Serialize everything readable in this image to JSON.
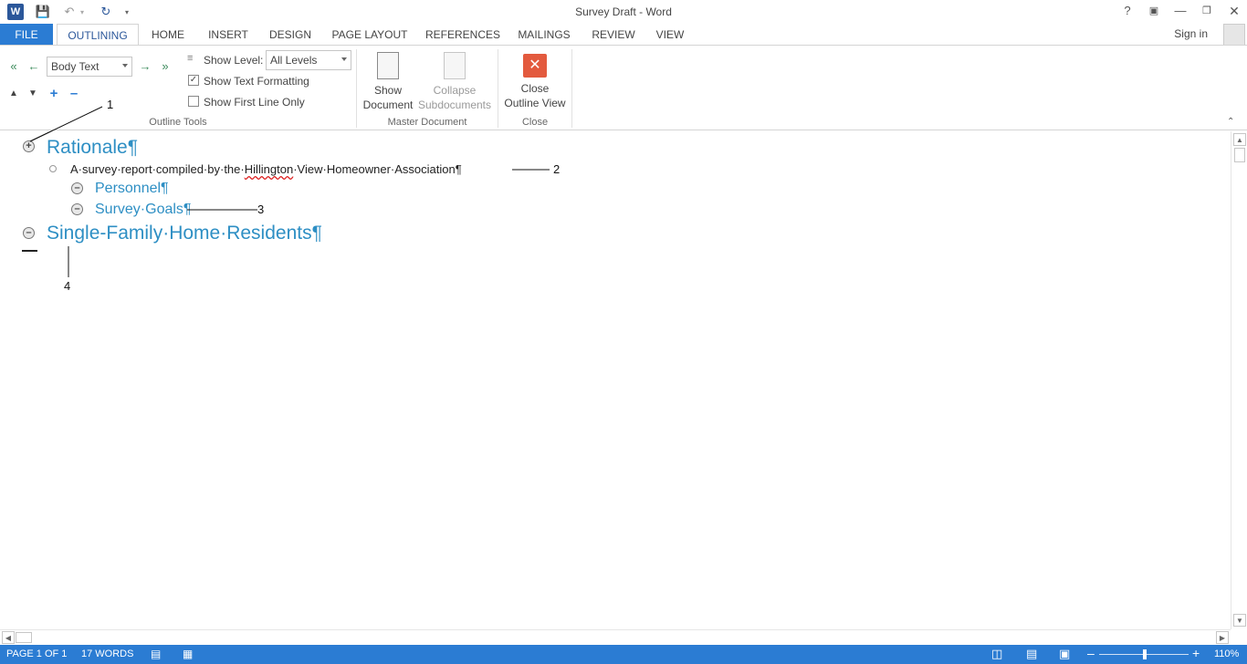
{
  "window": {
    "title": "Survey Draft - Word",
    "help": "?"
  },
  "tabs": [
    {
      "label": "FILE"
    },
    {
      "label": "OUTLINING"
    },
    {
      "label": "HOME"
    },
    {
      "label": "INSERT"
    },
    {
      "label": "DESIGN"
    },
    {
      "label": "PAGE LAYOUT"
    },
    {
      "label": "REFERENCES"
    },
    {
      "label": "MAILINGS"
    },
    {
      "label": "REVIEW"
    },
    {
      "label": "VIEW"
    }
  ],
  "account": {
    "signin": "Sign in"
  },
  "ribbon": {
    "outline_tools": {
      "level_value": "Body Text",
      "show_level_label": "Show Level:",
      "show_level_value": "All Levels",
      "show_text_formatting": "Show Text Formatting",
      "show_text_formatting_checked": true,
      "show_first_line_only": "Show First Line Only",
      "show_first_line_only_checked": false,
      "group_label": "Outline Tools"
    },
    "master_document": {
      "show_document_line1": "Show",
      "show_document_line2": "Document",
      "collapse_line1": "Collapse",
      "collapse_line2": "Subdocuments",
      "group_label": "Master Document"
    },
    "close": {
      "close_line1": "Close",
      "close_line2": "Outline View",
      "group_label": "Close"
    }
  },
  "document": {
    "heading1": "Rationale¶",
    "body_before": "A·survey·report·compiled·by·the·",
    "body_misspelled": "Hillington",
    "body_after": "·View·Homeowner·Association¶",
    "subheading1": "Personnel¶",
    "subheading2": "Survey·Goals¶",
    "heading2": "Single-Family·Home·Residents¶"
  },
  "callouts": {
    "c1": "1",
    "c2": "2",
    "c3": "3",
    "c4": "4"
  },
  "status": {
    "page": "PAGE 1 OF 1",
    "words": "17 WORDS",
    "zoom": "110%"
  },
  "colors": {
    "accent": "#2b7cd3",
    "heading": "#2e8fc4",
    "close_icon": "#e35a3e"
  }
}
